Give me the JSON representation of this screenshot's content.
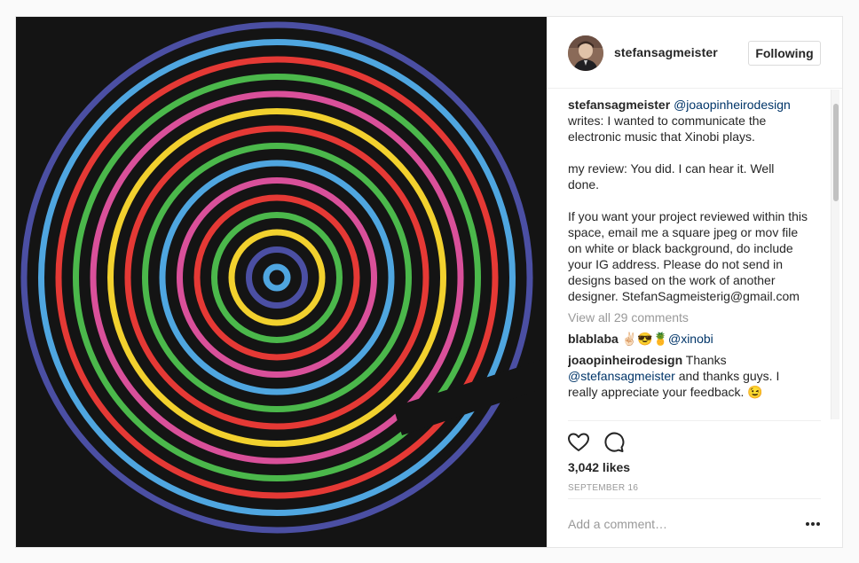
{
  "post": {
    "username": "stefansagmeister",
    "follow_label": "Following",
    "caption": {
      "author": "stefansagmeister",
      "mention": "@joaopinheirodesign",
      "text": " writes: I wanted to communicate the electronic music that Xinobi plays.\n\nmy review: You did. I can hear it. Well done.\n\nIf you want your project reviewed within this space, email me a square jpeg or mov file on white or black background, do include your IG address. Please do not send in designs based on the work of another designer. StefanSagmeisterig@gmail.com"
    },
    "view_all_comments": "View all 29 comments",
    "comments": [
      {
        "author": "blablaba",
        "emoji": "✌🏻😎🍍",
        "mention": "@xinobi",
        "text_before": "",
        "text_after": ""
      },
      {
        "author": "joaopinheirodesign",
        "text_before": " Thanks ",
        "mention": "@stefansagmeister",
        "text_after": " and thanks guys. I really appreciate your feedback. 😉"
      }
    ],
    "likes": "3,042 likes",
    "date": "SEPTEMBER 16",
    "add_comment_placeholder": "Add a comment…",
    "more_label": "•••"
  },
  "artwork": {
    "background": "#141414",
    "ring_colors": [
      "#4b4fa3",
      "#4fa6e0",
      "#4bb84b",
      "#e53935",
      "#f2d12e",
      "#d9509a"
    ]
  },
  "icons": {
    "like": "heart-icon",
    "comment": "speech-bubble-icon",
    "more": "more-dots-icon"
  }
}
